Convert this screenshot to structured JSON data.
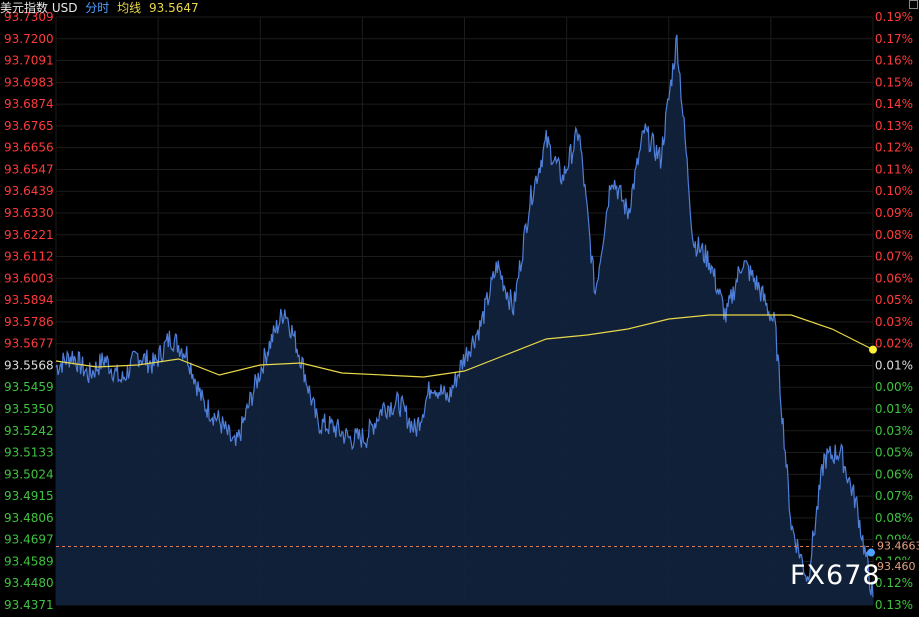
{
  "header": {
    "instrument": "美元指数 USD",
    "mode": "分时",
    "ma_label": "均线",
    "ma_value": "93.5647"
  },
  "watermark": "FX678",
  "colors": {
    "background": "#000000",
    "grid": "#1c1c1c",
    "price_line": "#4f7fd8",
    "area_fill": "#12233f",
    "ma_line": "#e8d84a",
    "up": "#ff3b3b",
    "down": "#3fc33f",
    "neutral": "#dddddd",
    "ref_line": "#e07a4a"
  },
  "chart_data": {
    "type": "line",
    "title": "",
    "xlabel": "",
    "ylabel": "",
    "ylim": [
      93.4371,
      93.7309
    ],
    "base_price": 93.5568,
    "grid": true,
    "y_ticks_left": [
      "93.7309",
      "93.7200",
      "93.7091",
      "93.6983",
      "93.6874",
      "93.6765",
      "93.6656",
      "93.6547",
      "93.6439",
      "93.6330",
      "93.6221",
      "93.6112",
      "93.6003",
      "93.5894",
      "93.5786",
      "93.5677",
      "93.5568",
      "93.5459",
      "93.5350",
      "93.5242",
      "93.5133",
      "93.5024",
      "93.4915",
      "93.4806",
      "93.4697",
      "93.4589",
      "93.4480",
      "93.4371"
    ],
    "y_ticks_right": [
      "0.19%",
      "0.17%",
      "0.16%",
      "0.15%",
      "0.14%",
      "0.13%",
      "0.12%",
      "0.11%",
      "0.10%",
      "0.09%",
      "0.08%",
      "0.07%",
      "0.06%",
      "0.05%",
      "0.03%",
      "0.02%",
      "0.01%",
      "0.00%",
      "0.01%",
      "0.03%",
      "0.05%",
      "0.06%",
      "0.07%",
      "0.08%",
      "0.09%",
      "0.10%",
      "0.12%",
      "0.13%"
    ],
    "series": [
      {
        "x": [
          0,
          2,
          4,
          6,
          8,
          10,
          12,
          14,
          16,
          18,
          20,
          22,
          24,
          26,
          28,
          30,
          32,
          34,
          36,
          38,
          40,
          42,
          44,
          46,
          48,
          50,
          52,
          54,
          56,
          58,
          60,
          62,
          64,
          66,
          68,
          70,
          72,
          74,
          76,
          78,
          80,
          82,
          84,
          86,
          88,
          90,
          92,
          94,
          96,
          98,
          100
        ],
        "values": [
          93.556,
          93.562,
          93.552,
          93.56,
          93.549,
          93.562,
          93.557,
          93.571,
          93.563,
          93.538,
          93.529,
          93.516,
          93.542,
          93.566,
          93.585,
          93.56,
          93.528,
          93.526,
          93.52,
          93.521,
          93.536,
          93.538,
          93.524,
          93.548,
          93.54,
          93.561,
          93.577,
          93.607,
          93.585,
          93.639,
          93.669,
          93.65,
          93.674,
          93.593,
          93.652,
          93.633,
          93.674,
          93.66,
          93.72,
          93.619,
          93.609,
          93.581,
          93.609,
          93.596,
          93.577,
          93.477,
          93.45,
          93.51,
          93.514,
          93.487,
          93.441
        ]
      },
      {
        "name": "均线",
        "x": [
          0,
          5,
          10,
          15,
          20,
          25,
          30,
          35,
          40,
          45,
          50,
          55,
          60,
          65,
          70,
          75,
          80,
          85,
          90,
          95,
          100
        ],
        "values": [
          93.559,
          93.556,
          93.557,
          93.56,
          93.552,
          93.557,
          93.558,
          93.553,
          93.552,
          93.551,
          93.554,
          93.562,
          93.57,
          93.572,
          93.575,
          93.58,
          93.582,
          93.582,
          93.582,
          93.575,
          93.5647
        ]
      }
    ],
    "markers": [
      {
        "label": "93.4663",
        "value": 93.4663
      },
      {
        "label": "93.460",
        "value": 93.46
      }
    ]
  }
}
